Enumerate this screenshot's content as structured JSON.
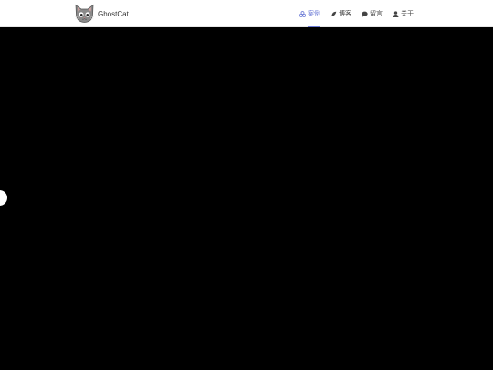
{
  "brand": {
    "name": "GhostCat",
    "logo_icon": "cat-face-icon"
  },
  "nav": {
    "items": [
      {
        "label": "案例",
        "icon": "cases-icon",
        "active": true
      },
      {
        "label": "博客",
        "icon": "feather-icon",
        "active": false
      },
      {
        "label": "留言",
        "icon": "comment-icon",
        "active": false
      },
      {
        "label": "关于",
        "icon": "user-icon",
        "active": false
      }
    ]
  },
  "colors": {
    "accent": "#6c7bd6",
    "navbar_bg": "#ffffff",
    "content_bg": "#000000",
    "text": "#444444"
  }
}
